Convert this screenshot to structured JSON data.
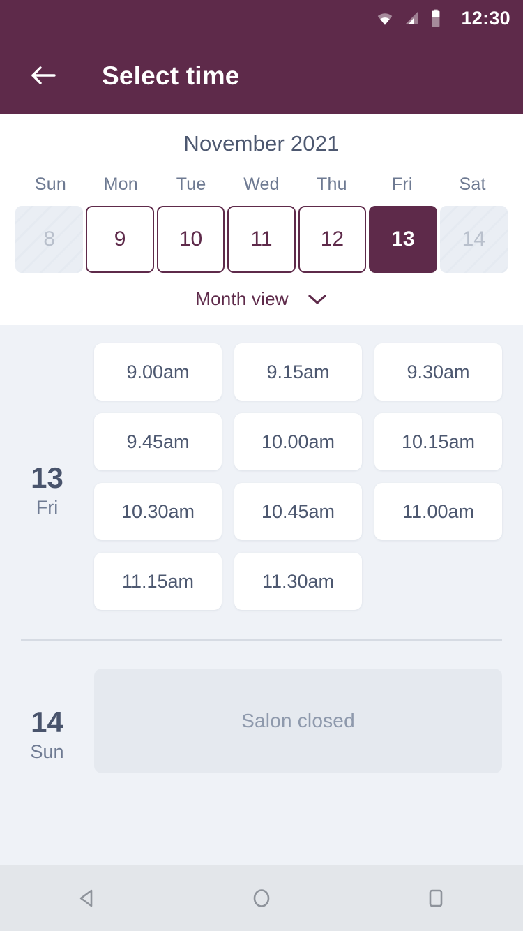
{
  "status_bar": {
    "time": "12:30",
    "icons": [
      "wifi-icon",
      "cell-signal-icon",
      "battery-icon"
    ]
  },
  "app_bar": {
    "back_icon": "arrow-left-icon",
    "title": "Select time"
  },
  "calendar": {
    "month_title": "November 2021",
    "weekdays": [
      "Sun",
      "Mon",
      "Tue",
      "Wed",
      "Thu",
      "Fri",
      "Sat"
    ],
    "days": [
      {
        "number": "8",
        "state": "disabled"
      },
      {
        "number": "9",
        "state": "available"
      },
      {
        "number": "10",
        "state": "available"
      },
      {
        "number": "11",
        "state": "available"
      },
      {
        "number": "12",
        "state": "available"
      },
      {
        "number": "13",
        "state": "selected"
      },
      {
        "number": "14",
        "state": "disabled"
      }
    ],
    "month_view_label": "Month view",
    "month_view_icon": "chevron-down-icon"
  },
  "schedule": [
    {
      "day_number": "13",
      "day_of_week": "Fri",
      "slots": [
        "9.00am",
        "9.15am",
        "9.30am",
        "9.45am",
        "10.00am",
        "10.15am",
        "10.30am",
        "10.45am",
        "11.00am",
        "11.15am",
        "11.30am"
      ]
    },
    {
      "day_number": "14",
      "day_of_week": "Sun",
      "closed_message": "Salon closed"
    }
  ],
  "nav_bar": {
    "back_icon": "triangle-back-icon",
    "home_icon": "circle-home-icon",
    "recents_icon": "square-recents-icon"
  },
  "colors": {
    "brand_maroon": "#5e2a4a",
    "page_bg": "#eff2f7",
    "card_white": "#ffffff",
    "text_slate": "#4d5870",
    "text_muted": "#6e7a92",
    "closed_bg": "#e5e9ef",
    "nav_bg": "#e3e6ea"
  }
}
